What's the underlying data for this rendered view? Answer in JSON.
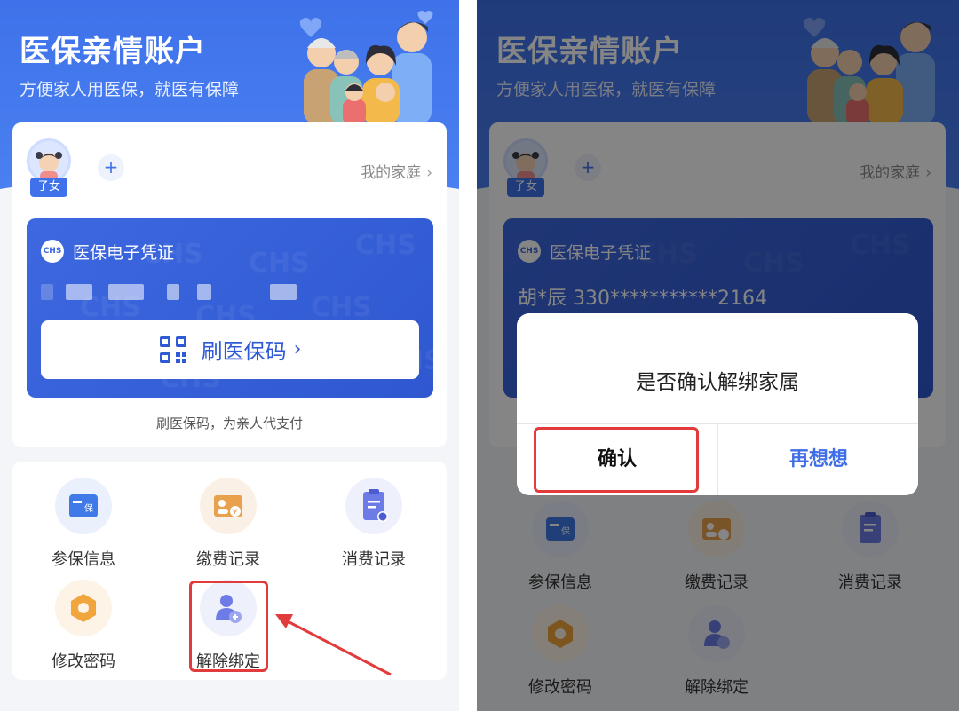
{
  "header": {
    "title": "医保亲情账户",
    "subtitle": "方便家人用医保，就医有保障"
  },
  "family": {
    "avatar_tag": "子女",
    "add_symbol": "+",
    "my_family_label": "我的家庭",
    "chevron": "›"
  },
  "ecard": {
    "logo_text": "CHS",
    "label": "医保电子凭证",
    "scan_label": "刷医保码",
    "scan_chevron": "›",
    "hint": "刷医保码，为亲人代支付",
    "holder_id": "胡*辰   330***********2164"
  },
  "menu": [
    {
      "label": "参保信息",
      "icon": "insurance-card-icon",
      "color": "#3f7ae8"
    },
    {
      "label": "缴费记录",
      "icon": "payment-record-icon",
      "color": "#e8a14d"
    },
    {
      "label": "消费记录",
      "icon": "consumption-record-icon",
      "color": "#6c7be6"
    },
    {
      "label": "修改密码",
      "icon": "change-password-icon",
      "color": "#f0a63c"
    },
    {
      "label": "解除绑定",
      "icon": "unbind-icon",
      "color": "#7b86e8"
    }
  ],
  "dialog": {
    "message": "是否确认解绑家属",
    "confirm_label": "确认",
    "rethink_label": "再想想"
  },
  "colors": {
    "primary": "#3f72ea",
    "highlight": "#e23b3b",
    "link": "#3f6ee6"
  }
}
